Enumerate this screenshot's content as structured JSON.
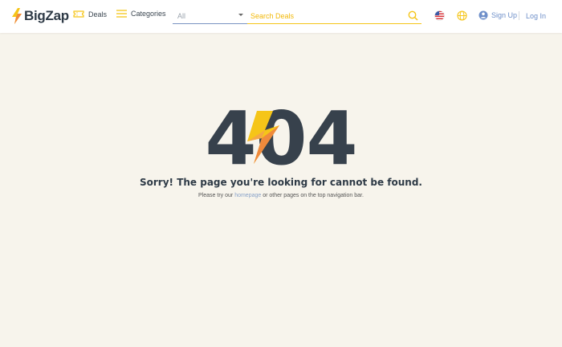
{
  "brand": {
    "name": "BigZap",
    "accent": "#f5c518",
    "accent_orange": "#f08a3c"
  },
  "nav": {
    "deals": {
      "label": "Deals",
      "icon": "ticket-icon"
    },
    "categories": {
      "label": "Categories",
      "icon": "menu-icon"
    }
  },
  "search": {
    "category_select": {
      "value": "All"
    },
    "placeholder": "Search Deals",
    "icon": "search-icon"
  },
  "header_right": {
    "flag_icon": "us-flag-icon",
    "globe_icon": "globe-icon",
    "signup_label": "Sign Up",
    "login_label": "Log In"
  },
  "error": {
    "code_left": "4",
    "code_middle": "0",
    "code_right": "4",
    "message": "Sorry! The page you're looking for cannot be found.",
    "hint_prefix": "Please try our",
    "hint_link": "homepage",
    "hint_suffix": "or other pages on the top navigation bar."
  }
}
